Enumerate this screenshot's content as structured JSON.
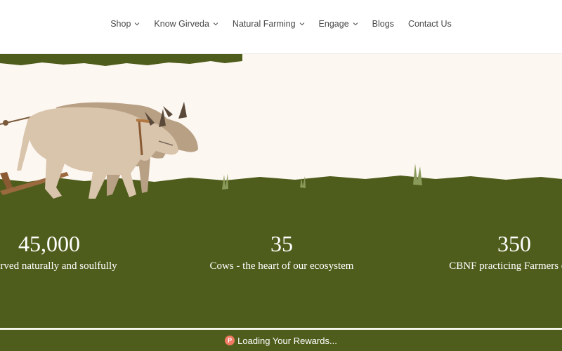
{
  "nav": {
    "items": [
      {
        "label": "Shop",
        "has_dropdown": true
      },
      {
        "label": "Know Girveda",
        "has_dropdown": true
      },
      {
        "label": "Natural Farming",
        "has_dropdown": true
      },
      {
        "label": "Engage",
        "has_dropdown": true
      },
      {
        "label": "Blogs",
        "has_dropdown": false
      },
      {
        "label": "Contact Us",
        "has_dropdown": false
      }
    ]
  },
  "hero": {
    "illustration": "oxen-plough-icon"
  },
  "stats": [
    {
      "number": "45,000",
      "caption": "rs served naturally and soulfully"
    },
    {
      "number": "35",
      "caption": "Cows - the heart of our ecosystem"
    },
    {
      "number": "350",
      "caption": "CBNF practicing Farmers emp"
    }
  ],
  "rewards": {
    "label": "Loading Your Rewards...",
    "coin_symbol": "P"
  },
  "colors": {
    "field_green": "#4f5d1c",
    "sky_cream": "#fdf7f1",
    "ox_tan": "#cdb8a0",
    "coin_red": "#f07a63"
  }
}
